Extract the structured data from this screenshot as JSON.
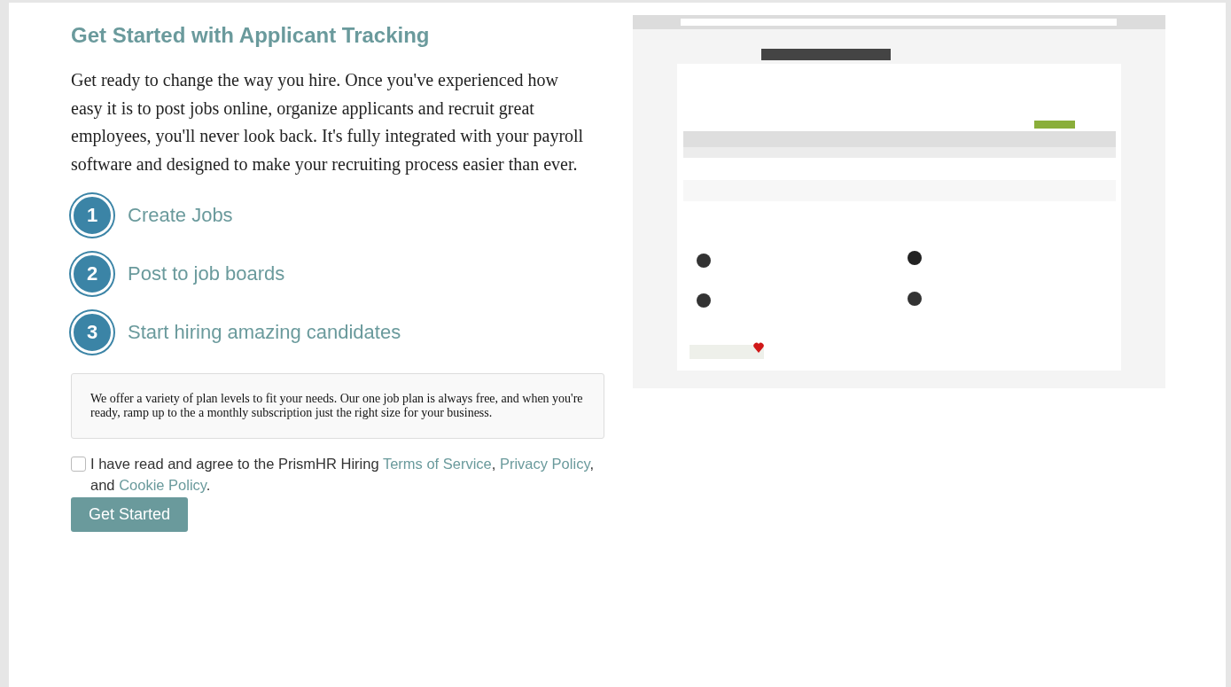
{
  "title": "Get Started with Applicant Tracking",
  "intro": "Get ready to change the way you hire. Once you've experienced how easy it is to post jobs online, organize applicants and recruit great employees, you'll never look back. It's fully integrated with your payroll software and designed to make your recruiting process easier than ever.",
  "steps": [
    {
      "number": "1",
      "label": "Create Jobs"
    },
    {
      "number": "2",
      "label": "Post to job boards"
    },
    {
      "number": "3",
      "label": "Start hiring amazing candidates"
    }
  ],
  "plan_note": "We offer a variety of plan levels to fit your needs. Our one job plan is always free, and when you're ready, ramp up to the a monthly subscription just the right size for your business.",
  "agreement": {
    "checked": false,
    "text_before": "I have read and agree to the PrismHR Hiring",
    "links": [
      "Terms of Service",
      "Privacy Policy",
      "Cookie Policy"
    ],
    "separators": [
      ",",
      ", and",
      "."
    ]
  },
  "button": "Get Started"
}
